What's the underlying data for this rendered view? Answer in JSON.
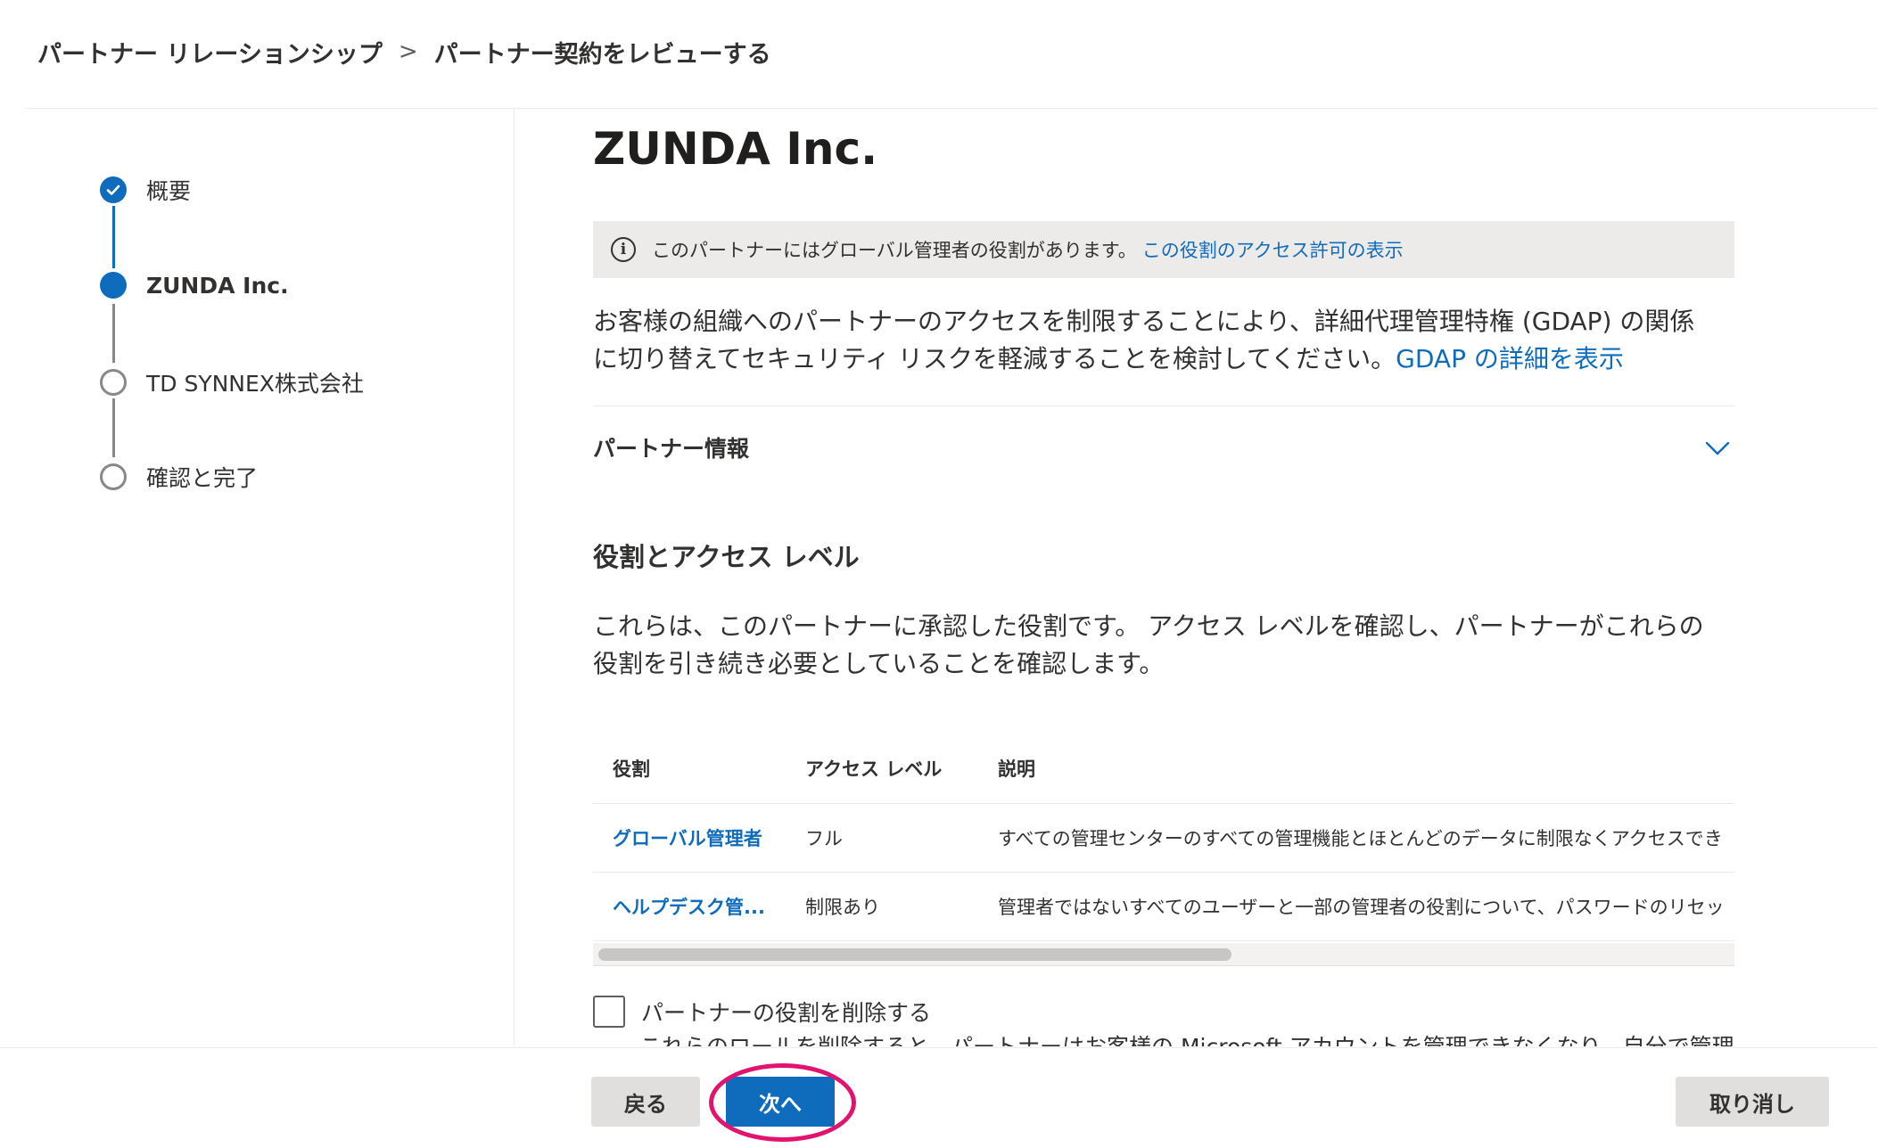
{
  "breadcrumb": {
    "parent": "パートナー リレーションシップ",
    "separator": ">",
    "current": "パートナー契約をレビューする"
  },
  "stepper": {
    "steps": [
      {
        "label": "概要",
        "status": "done"
      },
      {
        "label": "ZUNDA Inc.",
        "status": "current"
      },
      {
        "label": "TD SYNNEX株式会社",
        "status": "todo"
      },
      {
        "label": "確認と完了",
        "status": "todo"
      }
    ]
  },
  "main": {
    "title": "ZUNDA Inc.",
    "info_icon": "i",
    "info_text": "このパートナーにはグローバル管理者の役割があります。",
    "info_link": "この役割のアクセス許可の表示",
    "description_line1": "お客様の組織へのパートナーのアクセスを制限することにより、詳細代理管理特権 (GDAP) の関係",
    "description_line2": "に切り替えてセキュリティ リスクを軽減することを検討してください。",
    "gdap_link": "GDAP の詳細を表示",
    "partner_info_heading": "パートナー情報",
    "roles_heading": "役割とアクセス レベル",
    "roles_desc_line1": "これらは、このパートナーに承認した役割です。 アクセス レベルを確認し、パートナーがこれらの",
    "roles_desc_line2": "役割を引き続き必要としていることを確認します。",
    "table": {
      "headers": [
        "役割",
        "アクセス レベル",
        "説明"
      ],
      "rows": [
        [
          "グローバル管理者",
          "フル",
          "すべての管理センターのすべての管理機能とほとんどのデータに制限なくアクセスでき"
        ],
        [
          "ヘルプデスク管...",
          "制限あり",
          "管理者ではないすべてのユーザーと一部の管理者の役割について、パスワードのリセッ"
        ]
      ]
    },
    "checkbox_label": "パートナーの役割を削除する",
    "checkbox_desc": "これらのロールを削除すると、パートナーはお客様の Microsoft アカウントを管理できなくなり、自分で管理"
  },
  "footer": {
    "back_label": "戻る",
    "next_label": "次へ",
    "cancel_label": "取り消し"
  },
  "colors": {
    "accent": "#0f6cbd",
    "highlight": "#e2136e"
  }
}
